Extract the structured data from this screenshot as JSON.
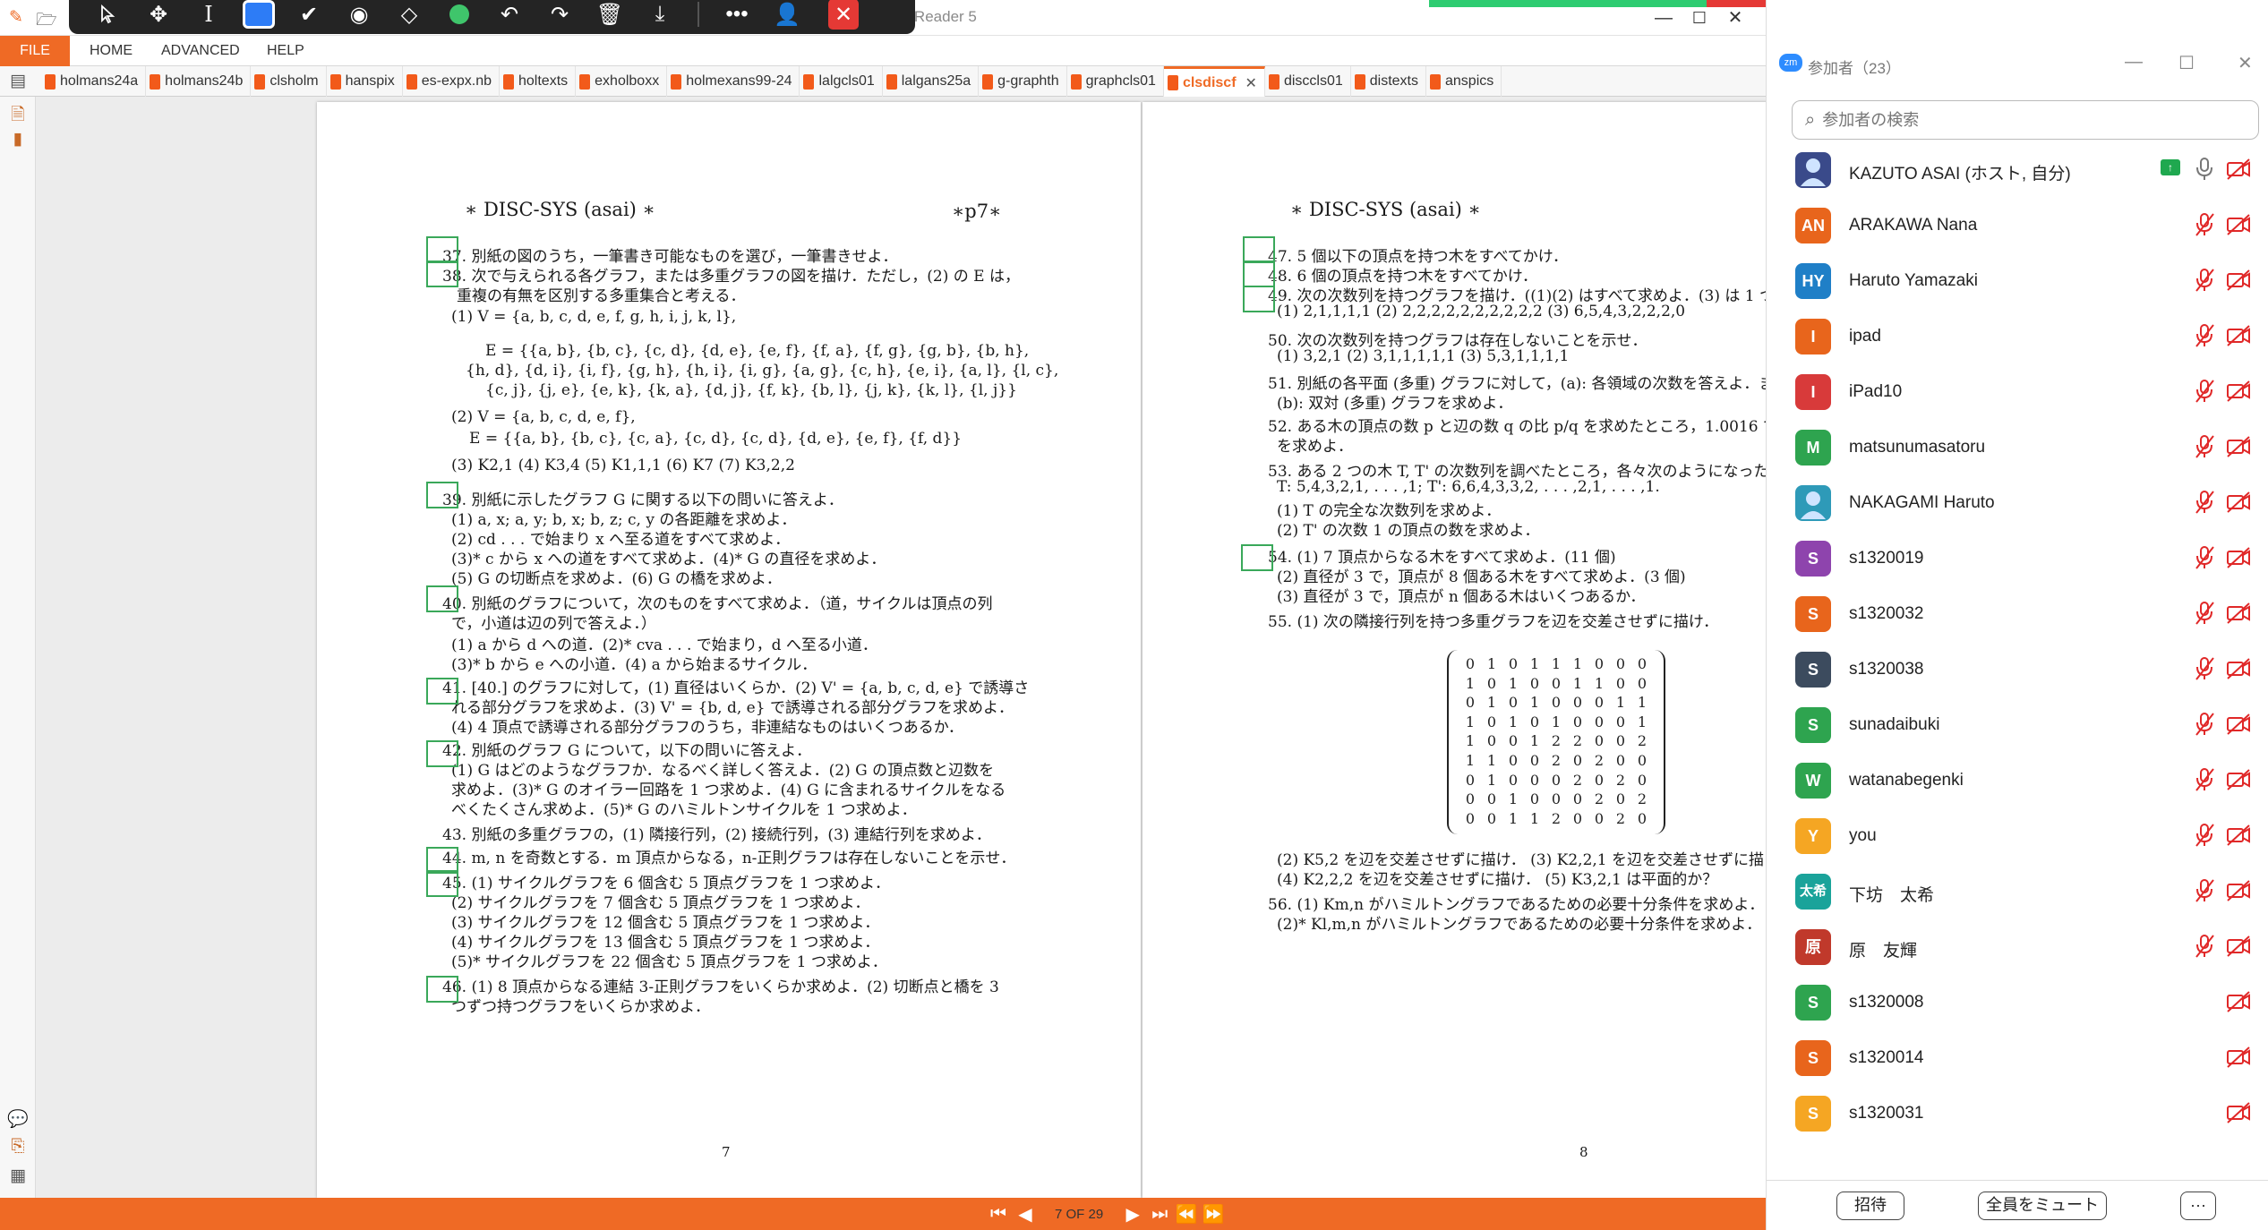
{
  "window": {
    "title": "clsdiscf.pdf - Nitro Reader 5",
    "minimize": "—",
    "maximize": "☐",
    "close": "✕"
  },
  "annotation_toolbar": {
    "tools": [
      "pointer-icon",
      "move-icon",
      "text-cursor-icon",
      "rectangle-icon",
      "check-icon",
      "stamp-icon",
      "eraser-icon",
      "color-dot-icon",
      "undo-icon",
      "redo-icon",
      "trash-icon",
      "save-icon",
      "more-icon",
      "user-icon",
      "close-icon"
    ],
    "active_color": "#3fc56b"
  },
  "ribbon": {
    "file_label": "FILE",
    "menus": [
      "HOME",
      "ADVANCED",
      "HELP"
    ]
  },
  "tabs": [
    {
      "label": "holmans24a"
    },
    {
      "label": "holmans24b"
    },
    {
      "label": "clsholm"
    },
    {
      "label": "hanspix"
    },
    {
      "label": "es-expx.nb"
    },
    {
      "label": "holtexts"
    },
    {
      "label": "exholboxx"
    },
    {
      "label": "holmexans99-24"
    },
    {
      "label": "lalgcls01"
    },
    {
      "label": "lalgans25a"
    },
    {
      "label": "g-graphth"
    },
    {
      "label": "graphcls01"
    },
    {
      "label": "clsdiscf",
      "active": true
    },
    {
      "label": "disccls01"
    },
    {
      "label": "distexts"
    },
    {
      "label": "anspics"
    }
  ],
  "page7": {
    "header": "∗ DISC-SYS (asai) ∗",
    "header_right": "∗p7∗",
    "lines": [
      "37. 別紙の図のうち，一筆書き可能なものを選び，一筆書きせよ．",
      "38. 次で与えられる各グラフ，または多重グラフの図を描け．ただし，(2) の E は，",
      "重複の有無を区別する多重集合と考える．",
      "(1) V = {a, b, c, d, e, f, g, h, i, j, k, l},",
      "E = {{a, b}, {b, c}, {c, d}, {d, e}, {e, f}, {f, a}, {f, g}, {g, b}, {b, h},",
      "{h, d}, {d, i}, {i, f}, {g, h}, {h, i}, {i, g}, {a, g}, {c, h}, {e, i}, {a, l}, {l, c},",
      "{c, j}, {j, e}, {e, k}, {k, a}, {d, j}, {f, k}, {b, l}, {j, k}, {k, l}, {l, j}}",
      "(2) V = {a, b, c, d, e, f},",
      "E = {{a, b}, {b, c}, {c, a}, {c, d}, {c, d}, {d, e}, {e, f}, {f, d}}",
      "(3) K2,1   (4) K3,4   (5) K1,1,1   (6) K7   (7) K3,2,2",
      "39. 別紙に示したグラフ G に関する以下の問いに答えよ．",
      "(1) a, x; a, y; b, x; b, z; c, y の各距離を求めよ．",
      "(2) cd . . . で始まり x へ至る道をすべて求めよ．",
      "(3)* c から x への道をすべて求めよ．(4)* G の直径を求めよ．",
      "(5) G の切断点を求めよ．(6) G の橋を求めよ．",
      "40. 別紙のグラフについて，次のものをすべて求めよ．（道，サイクルは頂点の列",
      "で，小道は辺の列で答えよ．）",
      "(1) a から d への道．(2)* cva . . . で始まり，d へ至る小道．",
      "(3)* b から e への小道．(4) a から始まるサイクル．",
      "41. [40.] のグラフに対して，(1) 直径はいくらか．(2) V' = {a, b, c, d, e} で誘導さ",
      "れる部分グラフを求めよ．(3) V' = {b, d, e} で誘導される部分グラフを求めよ．",
      "(4) 4 頂点で誘導される部分グラフのうち，非連結なものはいくつあるか．",
      "42. 別紙のグラフ G について，以下の問いに答えよ．",
      "(1) G はどのようなグラフか．なるべく詳しく答えよ．(2) G の頂点数と辺数を",
      "求めよ．(3)* G のオイラー回路を 1 つ求めよ．(4) G に含まれるサイクルをなる",
      "べくたくさん求めよ．(5)* G のハミルトンサイクルを 1 つ求めよ．",
      "43. 別紙の多重グラフの，(1) 隣接行列，(2) 接続行列，(3) 連結行列を求めよ．",
      "44. m, n を奇数とする．m 頂点からなる，n-正則グラフは存在しないことを示せ．",
      "45. (1) サイクルグラフを 6 個含む 5 頂点グラフを 1 つ求めよ．",
      "(2) サイクルグラフを 7 個含む 5 頂点グラフを 1 つ求めよ．",
      "(3) サイクルグラフを 12 個含む 5 頂点グラフを 1 つ求めよ．",
      "(4) サイクルグラフを 13 個含む 5 頂点グラフを 1 つ求めよ．",
      "(5)* サイクルグラフを 22 個含む 5 頂点グラフを 1 つ求めよ．",
      "46. (1) 8 頂点からなる連結 3-正則グラフをいくらか求めよ．(2) 切断点と橋を 3",
      "つずつ持つグラフをいくらか求めよ．"
    ],
    "page_number": "7"
  },
  "page8": {
    "header": "∗ DISC-SYS (asai) ∗",
    "lines": [
      "47. 5 個以下の頂点を持つ木をすべてかけ．",
      "48. 6 個の頂点を持つ木をすべてかけ．",
      "49. 次の次数列を持つグラフを描け．((1)(2) はすべて求めよ．(3) は 1 つ",
      "(1) 2,1,1,1,1      (2) 2,2,2,2,2,2,2,2,2,2      (3) 6,5,4,3,2,2,2,0",
      "50. 次の次数列を持つグラフは存在しないことを示せ．",
      "(1) 3,2,1      (2) 3,1,1,1,1,1      (3) 5,3,1,1,1,1",
      "51. 別紙の各平面 (多重) グラフに対して，(a): 各領域の次数を答えよ．ま",
      "(b): 双対 (多重) グラフを求めよ．",
      "52. ある木の頂点の数 p と辺の数 q の比 p/q を求めたところ，1.0016 であ",
      "を求めよ．",
      "53. ある 2 つの木 T, T' の次数列を調べたところ，各々次のようになった",
      "T: 5,4,3,2,1, . . . ,1;  T': 6,6,4,3,3,2, . . . ,2,1, . . . ,1.",
      "(1) T の完全な次数列を求めよ．",
      "(2) T' の次数 1 の頂点の数を求めよ．",
      "54. (1) 7 頂点からなる木をすべて求めよ．(11 個)",
      "(2) 直径が 3 で，頂点が 8 個ある木をすべて求めよ．(3 個)",
      "(3) 直径が 3 で，頂点が n 個ある木はいくつあるか．",
      "55. (1) 次の隣接行列を持つ多重グラフを辺を交差させずに描け．"
    ],
    "matrix": [
      [
        "0",
        "1",
        "0",
        "1",
        "1",
        "1",
        "0",
        "0",
        "0"
      ],
      [
        "1",
        "0",
        "1",
        "0",
        "0",
        "1",
        "1",
        "0",
        "0"
      ],
      [
        "0",
        "1",
        "0",
        "1",
        "0",
        "0",
        "0",
        "1",
        "1"
      ],
      [
        "1",
        "0",
        "1",
        "0",
        "1",
        "0",
        "0",
        "0",
        "1"
      ],
      [
        "1",
        "0",
        "0",
        "1",
        "2",
        "2",
        "0",
        "0",
        "2"
      ],
      [
        "1",
        "1",
        "0",
        "0",
        "2",
        "0",
        "2",
        "0",
        "0"
      ],
      [
        "0",
        "1",
        "0",
        "0",
        "0",
        "2",
        "0",
        "2",
        "0"
      ],
      [
        "0",
        "0",
        "1",
        "0",
        "0",
        "0",
        "2",
        "0",
        "2"
      ],
      [
        "0",
        "0",
        "1",
        "1",
        "2",
        "0",
        "0",
        "2",
        "0"
      ]
    ],
    "lines_after": [
      "(2) K5,2 を辺を交差させずに描け．   (3) K2,2,1 を辺を交差させずに描け",
      "(4) K2,2,2 を辺を交差させずに描け．   (5) K3,2,1 は平面的か？",
      "56. (1) Km,n がハミルトングラフであるための必要十分条件を求めよ．",
      "(2)* Kl,m,n がハミルトングラフであるための必要十分条件を求めよ．"
    ],
    "page_number": "8"
  },
  "status": {
    "page_indicator": "7 OF 29"
  },
  "zoom_panel": {
    "logo": "zm",
    "title": "参加者（23）",
    "search_placeholder": "参加者の検索",
    "participants": [
      {
        "initials": "",
        "name": "KAZUTO ASAI (ホスト, 自分)",
        "color": "#3a4a8a",
        "mic": "on",
        "share": true
      },
      {
        "initials": "AN",
        "name": "ARAKAWA Nana",
        "color": "#e8651c",
        "mic": "muted"
      },
      {
        "initials": "HY",
        "name": "Haruto Yamazaki",
        "color": "#1f7fc7",
        "mic": "muted"
      },
      {
        "initials": "I",
        "name": "ipad",
        "color": "#e8651c",
        "mic": "muted"
      },
      {
        "initials": "I",
        "name": "iPad10",
        "color": "#d83a3a",
        "mic": "muted"
      },
      {
        "initials": "M",
        "name": "matsunumasatoru",
        "color": "#2ea44f",
        "mic": "muted"
      },
      {
        "initials": "",
        "name": "NAKAGAMI Haruto",
        "color": "#2e9ab8",
        "mic": "muted"
      },
      {
        "initials": "S",
        "name": "s1320019",
        "color": "#8e44ad",
        "mic": "muted"
      },
      {
        "initials": "S",
        "name": "s1320032",
        "color": "#e8651c",
        "mic": "muted"
      },
      {
        "initials": "S",
        "name": "s1320038",
        "color": "#3c4b5e",
        "mic": "muted"
      },
      {
        "initials": "S",
        "name": "sunadaibuki",
        "color": "#2ea44f",
        "mic": "muted"
      },
      {
        "initials": "W",
        "name": "watanabegenki",
        "color": "#2ea44f",
        "mic": "muted"
      },
      {
        "initials": "Y",
        "name": "you",
        "color": "#f5a623",
        "mic": "muted"
      },
      {
        "initials": "太希",
        "name": "下坊　太希",
        "color": "#1aa39a",
        "mic": "muted"
      },
      {
        "initials": "原",
        "name": "原　友輝",
        "color": "#c0392b",
        "mic": "muted"
      },
      {
        "initials": "S",
        "name": "s1320008",
        "color": "#2ea44f",
        "mic": "none"
      },
      {
        "initials": "S",
        "name": "s1320014",
        "color": "#e8651c",
        "mic": "none"
      },
      {
        "initials": "S",
        "name": "s1320031",
        "color": "#f5a623",
        "mic": "none"
      }
    ],
    "invite_label": "招待",
    "mute_all_label": "全員をミュート",
    "more_label": "···"
  }
}
